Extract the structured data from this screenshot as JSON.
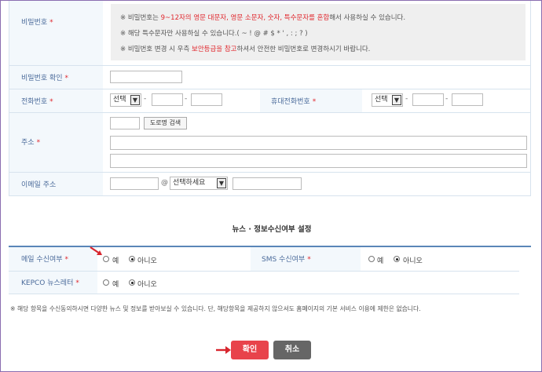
{
  "password": {
    "label": "비밀번호",
    "notes": {
      "n1_prefix": "※ 비밀번호는 ",
      "n1_red": "9~12자의 영문 대문자, 영문 소문자, 숫자, 특수문자를 혼합",
      "n1_suffix": "해서 사용하실 수 있습니다.",
      "n2": "※ 해당 특수문자만 사용하실 수 있습니다.( ~ ! @ # $ * ' , : ; ? )",
      "n3_prefix": "※ 비밀번호 변경 시 우측 ",
      "n3_red": "보안등급을 참고",
      "n3_suffix": "하셔서 안전한 비밀번호로 변경하시기 바랍니다."
    }
  },
  "password_confirm": {
    "label": "비밀번호 확인"
  },
  "phone": {
    "label": "전화번호",
    "select_value": "선택"
  },
  "mobile": {
    "label": "휴대전화번호",
    "select_value": "선택"
  },
  "address": {
    "label": "주소",
    "search_button": "도로명 검색"
  },
  "email": {
    "label": "이메일 주소",
    "at": "@",
    "select_value": "선택하세요"
  },
  "required_mark": "*",
  "dash": "-",
  "news_section": {
    "title": "뉴스 · 정보수신여부 설정",
    "email_opt": {
      "label": "메일 수신여부",
      "yes": "예",
      "no": "아니오",
      "selected": "no"
    },
    "sms_opt": {
      "label": "SMS 수신여부",
      "yes": "예",
      "no": "아니오",
      "selected": "no"
    },
    "newsletter_opt": {
      "label": "KEPCO 뉴스레터",
      "yes": "예",
      "no": "아니오",
      "selected": "no"
    },
    "disclaimer": "※ 해당 항목을 수신동의하시면 다양한 뉴스 및 정보를 받아보실 수 있습니다. 단, 해당항목을 제공하지 않으셔도 홈페이지의 기본 서비스 이용에 제한은 없습니다."
  },
  "buttons": {
    "confirm": "확인",
    "cancel": "취소"
  },
  "colors": {
    "accent_red": "#e0282e",
    "label_blue": "#4a6a9a",
    "confirm_bg": "#e8434b",
    "cancel_bg": "#666666",
    "frame": "#8a6db0"
  }
}
